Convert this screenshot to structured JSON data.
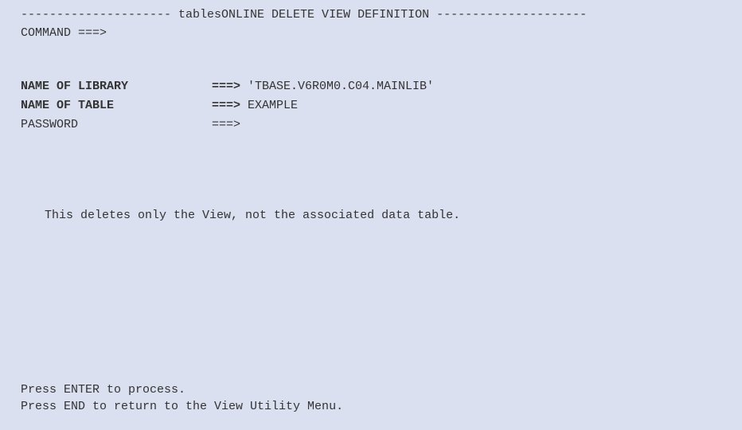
{
  "title_line": "--------------------- tablesONLINE DELETE VIEW DEFINITION ---------------------",
  "command": {
    "label": "COMMAND ===>",
    "value": ""
  },
  "fields": {
    "library": {
      "label": "NAME OF LIBRARY",
      "arrow": "===> ",
      "value": "'TBASE.V6R0M0.C04.MAINLIB'"
    },
    "table": {
      "label": "NAME OF TABLE",
      "arrow": "===> ",
      "value": "EXAMPLE"
    },
    "password": {
      "label": "PASSWORD",
      "arrow": "===>",
      "value": ""
    }
  },
  "info": "This deletes only the View, not the associated data table.",
  "footer": {
    "line1": "Press ENTER to process.",
    "line2": "Press END to return to the View Utility Menu."
  }
}
